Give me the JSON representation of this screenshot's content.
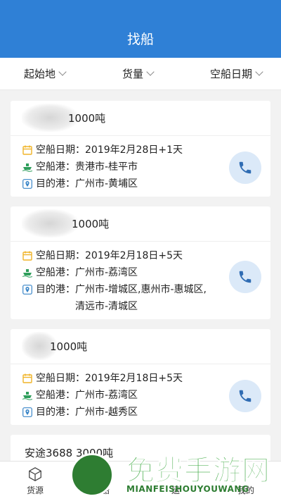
{
  "header": {
    "title": "找船"
  },
  "filters": [
    {
      "label": "起始地"
    },
    {
      "label": "货量"
    },
    {
      "label": "空船日期"
    }
  ],
  "labels": {
    "date": "空船日期：",
    "port": "空船港：",
    "dest": "目的港："
  },
  "cards": [
    {
      "name": "1000吨",
      "date": "2019年2月28日+1天",
      "port": "贵港市-桂平市",
      "dest": "广州市-黄埔区"
    },
    {
      "name": "1000吨",
      "date": "2019年2月18日+5天",
      "port": "广州市-荔湾区",
      "dest": "广州市-增城区,惠州市-惠城区,清远市-清城区"
    },
    {
      "name": "1000吨",
      "date": "2019年2月18日+5天",
      "port": "广州市-荔湾区",
      "dest": "广州市-越秀区"
    },
    {
      "name": "安途3688   3000吨"
    }
  ],
  "tabs": [
    {
      "label": "货源",
      "icon": "cube-icon"
    },
    {
      "label": "船"
    },
    {
      "label": "运"
    },
    {
      "label": "我的"
    }
  ],
  "watermark": {
    "title": "免费手游网",
    "subtitle": "MIANFEISHOUYOUWANG"
  },
  "colors": {
    "primary": "#2f80d6",
    "phone_bg": "#dbe9f8",
    "calendar": "#f0b429",
    "ship": "#2e9e5b",
    "pin": "#3a86c8"
  }
}
